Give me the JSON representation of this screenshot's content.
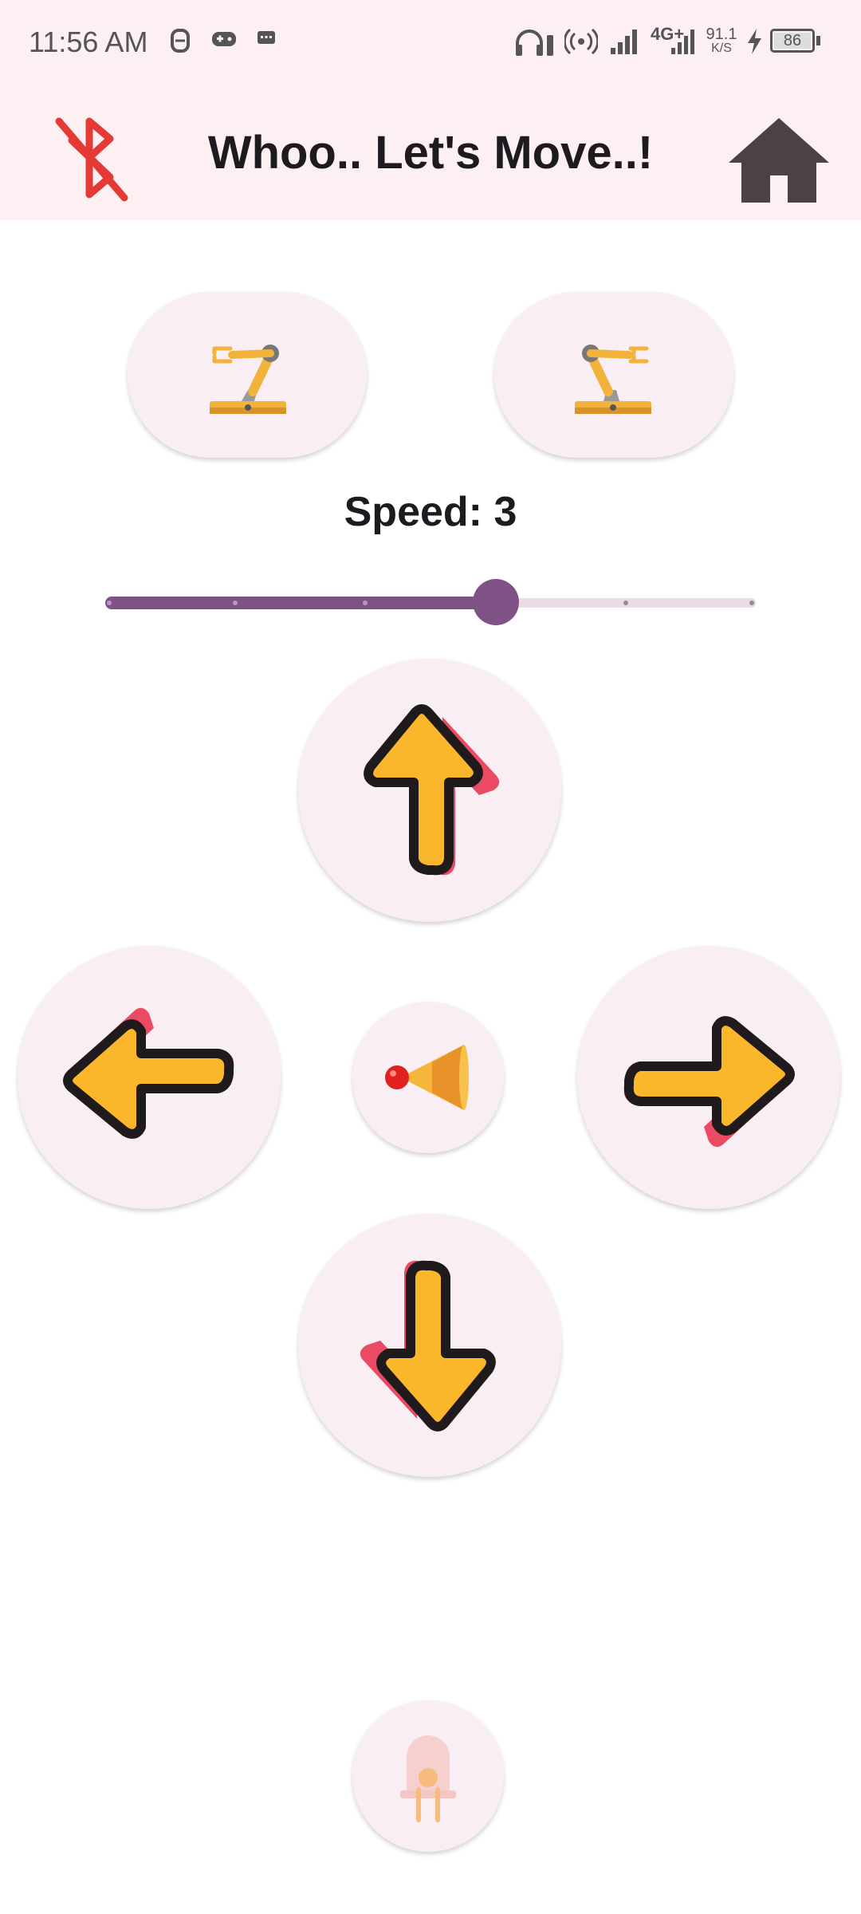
{
  "status_bar": {
    "time": "11:56 AM",
    "network": "4G+",
    "speed_value": "91.1",
    "speed_unit": "K/S",
    "battery": "86"
  },
  "app_bar": {
    "title": "Whoo.. Let's Move..!"
  },
  "speed": {
    "label": "Speed: 3",
    "value": 3,
    "min": 0,
    "max": 5
  },
  "colors": {
    "accent": "#7e5285",
    "bluetooth_off": "#e53935",
    "home": "#4b4248",
    "button_bg": "#f9eef4"
  },
  "icons": {
    "bluetooth": "bluetooth-disabled-icon",
    "home": "home-icon",
    "arm_left": "robot-arm-open-icon",
    "arm_right": "robot-arm-close-icon",
    "up": "arrow-up-icon",
    "down": "arrow-down-icon",
    "left": "arrow-left-icon",
    "right": "arrow-right-icon",
    "horn": "horn-icon",
    "light": "led-icon"
  }
}
